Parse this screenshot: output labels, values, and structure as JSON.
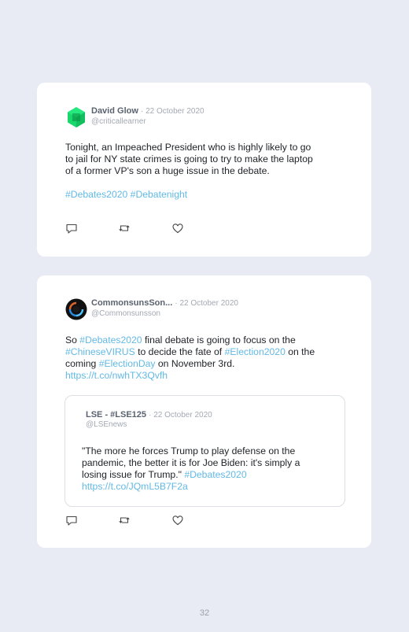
{
  "tweets": [
    {
      "name": "David Glow",
      "date": "· 22 October 2020",
      "handle": "@criticallearner",
      "body": {
        "line1": "Tonight, an Impeached President who is highly likely to go",
        "line2": "to jail for NY state crimes is going to try to make the laptop",
        "line3": "of a former VP's son a huge issue in the debate."
      },
      "hashtags": "#Debates2020 #Debatenight"
    },
    {
      "name": "CommonsunsSon...",
      "date": "· 22 October 2020",
      "handle": "@Commonsunsson",
      "body": {
        "p1": "So ",
        "t1": "#Debates2020",
        "p2": " final debate is going to focus on the",
        "t2": "#ChineseVIRUS",
        "p3": " to decide the fate of ",
        "t3": "#Election2020",
        "p4": " on the",
        "p5": "coming ",
        "t4": "#ElectionDay",
        "p6": " on November 3rd.",
        "link": "https://t.co/nwhTX3Qvfh"
      },
      "quote": {
        "name": "LSE - #LSE125",
        "date": "· 22 October 2020",
        "handle": "@LSEnews",
        "line1": "\"The more he forces Trump to play defense on the",
        "line2": "pandemic, the better it is for Joe Biden: it's simply a",
        "line3_text": "losing issue for Trump.\" ",
        "line3_tag": "#Debates2020",
        "link": "https://t.co/JQmL5B7F2a"
      }
    }
  ],
  "icons": {
    "reply": "reply-icon",
    "retweet": "retweet-icon",
    "like": "like-icon"
  },
  "colors": {
    "background": "#e8ebf3",
    "card": "#ffffff",
    "hashtag": "#62b9e6",
    "name": "#5a6270",
    "muted": "#a3a9b3"
  },
  "page_number": "32"
}
